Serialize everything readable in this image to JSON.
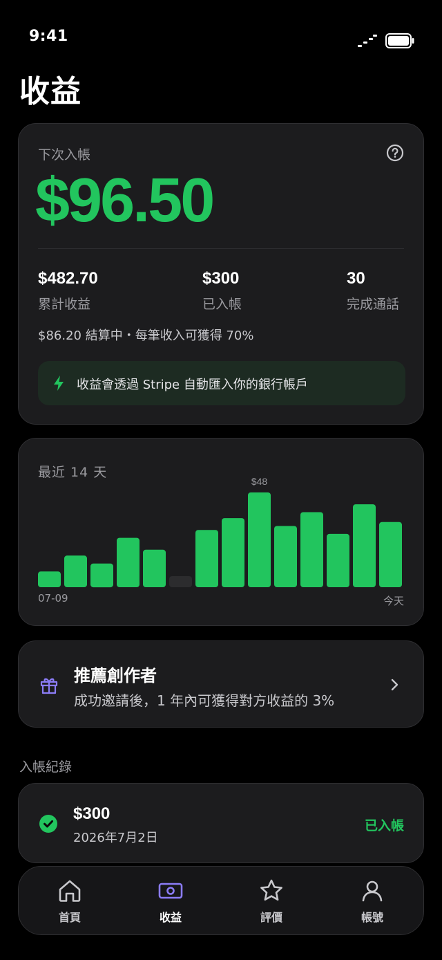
{
  "status_bar": {
    "time": "9:41"
  },
  "page_title": "收益",
  "payout": {
    "next_label": "下次入帳",
    "amount": "$96.50",
    "stats": [
      {
        "value": "$482.70",
        "label": "累計收益"
      },
      {
        "value": "$300",
        "label": "已入帳"
      },
      {
        "value": "30",
        "label": "完成通話"
      }
    ],
    "pending_note": "$86.20 結算中・每筆收入可獲得 70%",
    "stripe_note": "收益會透過 Stripe 自動匯入你的銀行帳戶"
  },
  "chart_data": {
    "type": "bar",
    "title": "最近 14 天",
    "x_start_label": "07-09",
    "x_end_label": "今天",
    "peak_label": "$48",
    "values": [
      8,
      16,
      12,
      25,
      19,
      0,
      29,
      35,
      48,
      31,
      38,
      27,
      42,
      33
    ],
    "ylim": [
      0,
      48
    ],
    "bar_color": "#22c55e",
    "empty_bar_color": "#2c2c2e"
  },
  "referral": {
    "title": "推薦創作者",
    "subtitle": "成功邀請後，1 年內可獲得對方收益的 3%"
  },
  "history": {
    "section_title": "入帳紀錄",
    "items": [
      {
        "amount": "$300",
        "date": "2026年7月2日",
        "status": "已入帳"
      }
    ]
  },
  "tabs": [
    {
      "label": "首頁",
      "icon": "home-icon",
      "active": false
    },
    {
      "label": "收益",
      "icon": "wallet-icon",
      "active": true
    },
    {
      "label": "評價",
      "icon": "star-icon",
      "active": false
    },
    {
      "label": "帳號",
      "icon": "user-icon",
      "active": false
    }
  ],
  "colors": {
    "accent": "#22c55e",
    "purple": "#8b7cf6",
    "card": "#1c1c1e"
  }
}
